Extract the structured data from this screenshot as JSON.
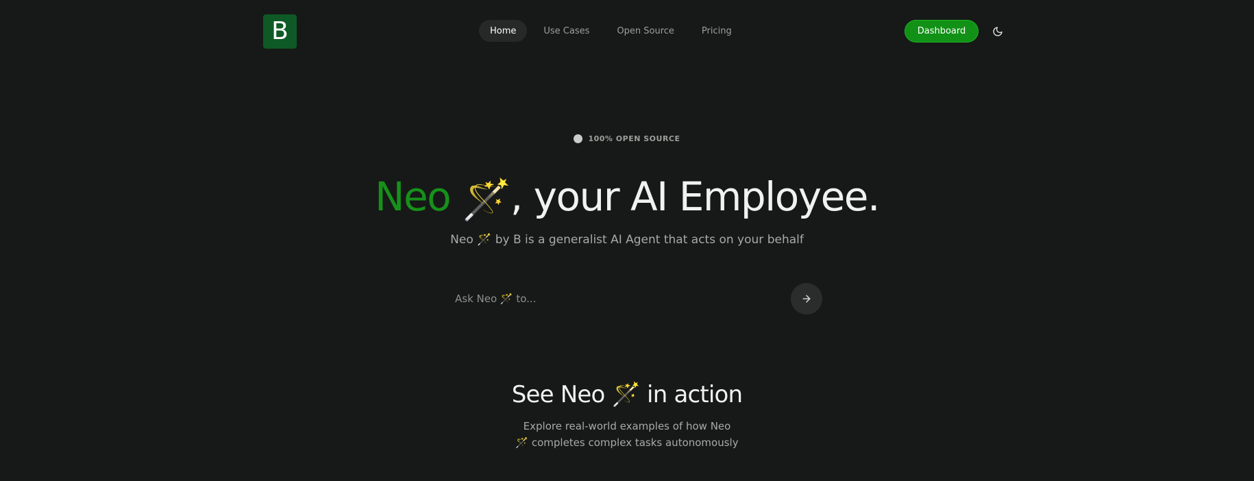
{
  "header": {
    "logo_letter": "B",
    "nav": [
      {
        "label": "Home",
        "active": true
      },
      {
        "label": "Use Cases",
        "active": false
      },
      {
        "label": "Open Source",
        "active": false
      },
      {
        "label": "Pricing",
        "active": false
      }
    ],
    "dashboard_label": "Dashboard",
    "theme_icon": "moon-icon"
  },
  "hero": {
    "badge": "100% OPEN SOURCE",
    "title_brand": "Neo",
    "title_emoji": "🪄",
    "title_rest": ", your AI Employee.",
    "subtitle_prefix": "Neo",
    "subtitle_emoji": "🪄",
    "subtitle_text": "by B is a generalist AI Agent that acts on your behalf"
  },
  "ask": {
    "placeholder": "Ask Neo 🪄 to..."
  },
  "section": {
    "title_prefix": "See Neo",
    "title_emoji": "🪄",
    "title_suffix": "in action",
    "desc_line1": "Explore real-world examples of how Neo",
    "desc_line2": "🪄 completes complex tasks autonomously"
  },
  "colors": {
    "background": "#161917",
    "brand_green": "#16911a",
    "logo_green": "#0e5a26",
    "button_green": "#119116"
  }
}
